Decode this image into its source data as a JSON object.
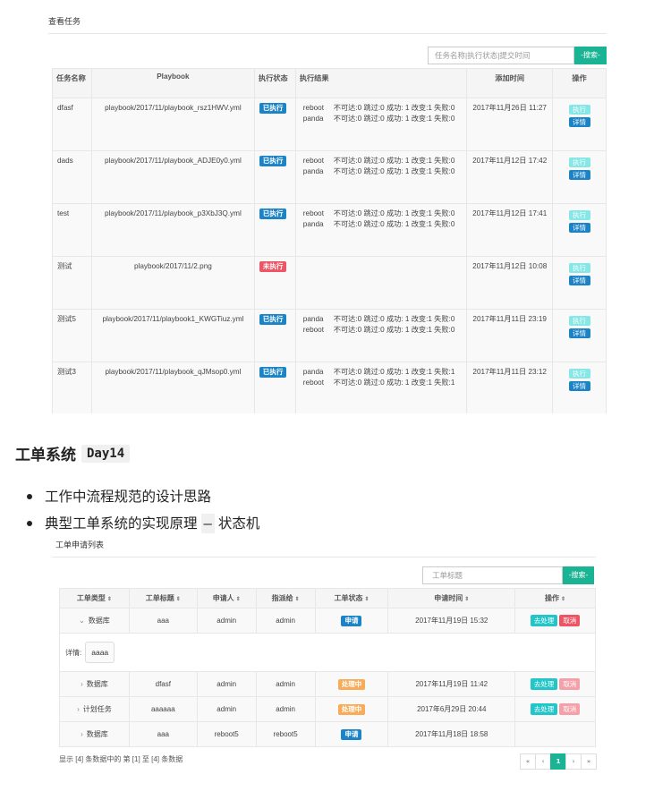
{
  "task_panel": {
    "title": "查看任务",
    "search_placeholder": "任务名称|执行状态|提交时间",
    "search_button": "-搜索-",
    "columns": [
      "任务名称",
      "Playbook",
      "执行状态",
      "执行结果",
      "添加时间",
      "操作"
    ],
    "rows": [
      {
        "name": "dfasf",
        "playbook": "playbook/2017/11/playbook_rsz1HWV.yml",
        "status": "已执行",
        "status_kind": "done",
        "results": [
          {
            "host": "reboot",
            "text": "不可达:0 跳过:0 成功: 1 改变:1 失败:0"
          },
          {
            "host": "panda",
            "text": "不可达:0 跳过:0 成功: 1 改变:1 失败:0"
          }
        ],
        "time": "2017年11月26日 11:27",
        "exec": "执行",
        "detail": "详情"
      },
      {
        "name": "dads",
        "playbook": "playbook/2017/11/playbook_ADJE0y0.yml",
        "status": "已执行",
        "status_kind": "done",
        "results": [
          {
            "host": "reboot",
            "text": "不可达:0 跳过:0 成功: 1 改变:1 失败:0"
          },
          {
            "host": "panda",
            "text": "不可达:0 跳过:0 成功: 1 改变:1 失败:0"
          }
        ],
        "time": "2017年11月12日 17:42",
        "exec": "执行",
        "detail": "详情"
      },
      {
        "name": "test",
        "playbook": "playbook/2017/11/playbook_p3XbJ3Q.yml",
        "status": "已执行",
        "status_kind": "done",
        "results": [
          {
            "host": "reboot",
            "text": "不可达:0 跳过:0 成功: 1 改变:1 失败:0"
          },
          {
            "host": "panda",
            "text": "不可达:0 跳过:0 成功: 1 改变:1 失败:0"
          }
        ],
        "time": "2017年11月12日 17:41",
        "exec": "执行",
        "detail": "详情"
      },
      {
        "name": "测试",
        "playbook": "playbook/2017/11/2.png",
        "status": "未执行",
        "status_kind": "pending",
        "results": [],
        "time": "2017年11月12日 10:08",
        "exec": "执行",
        "detail": "详情"
      },
      {
        "name": "测试5",
        "playbook": "playbook/2017/11/playbook1_KWGTiuz.yml",
        "status": "已执行",
        "status_kind": "done",
        "results": [
          {
            "host": "panda",
            "text": "不可达:0 跳过:0 成功: 1 改变:1 失败:0"
          },
          {
            "host": "reboot",
            "text": "不可达:0 跳过:0 成功: 1 改变:1 失败:0"
          }
        ],
        "time": "2017年11月11日 23:19",
        "exec": "执行",
        "detail": "详情"
      },
      {
        "name": "测试3",
        "playbook": "playbook/2017/11/playbook_qJMsop0.yml",
        "status": "已执行",
        "status_kind": "done",
        "results": [
          {
            "host": "panda",
            "text": "不可达:0 跳过:0 成功: 1 改变:1 失败:1"
          },
          {
            "host": "reboot",
            "text": "不可达:0 跳过:0 成功: 1 改变:1 失败:1"
          }
        ],
        "time": "2017年11月11日 23:12",
        "exec": "执行",
        "detail": "详情"
      }
    ]
  },
  "article": {
    "heading": "工单系统",
    "heading_code": "Day14",
    "bullets": [
      {
        "text": "工作中流程规范的设计思路",
        "code": ""
      },
      {
        "text": "典型工单系统的实现原理",
        "code": "—",
        "suffix": "状态机"
      }
    ]
  },
  "ticket_panel": {
    "title": "工单申请列表",
    "search_placeholder": "工单标题",
    "search_button": "-搜索-",
    "columns": [
      "工单类型",
      "工单标题",
      "申请人",
      "指派给",
      "工单状态",
      "申请时间",
      "操作"
    ],
    "detail_label": "详情:",
    "detail_value": "aaaa",
    "rows": [
      {
        "type": "数据库",
        "expanded": true,
        "title": "aaa",
        "applicant": "admin",
        "assignee": "admin",
        "status": "申请",
        "status_kind": "apply",
        "time": "2017年11月19日 15:32",
        "actions": [
          "去处理",
          "取消"
        ],
        "cancel_active": true
      },
      {
        "type": "数据库",
        "expanded": false,
        "title": "dfasf",
        "applicant": "admin",
        "assignee": "admin",
        "status": "处理中",
        "status_kind": "processing",
        "time": "2017年11月19日 11:42",
        "actions": [
          "去处理",
          "取消"
        ],
        "cancel_active": false
      },
      {
        "type": "计划任务",
        "expanded": false,
        "title": "aaaaaa",
        "applicant": "admin",
        "assignee": "admin",
        "status": "处理中",
        "status_kind": "processing",
        "time": "2017年6月29日 20:44",
        "actions": [
          "去处理",
          "取消"
        ],
        "cancel_active": false
      },
      {
        "type": "数据库",
        "expanded": false,
        "title": "aaa",
        "applicant": "reboot5",
        "assignee": "reboot5",
        "status": "申请",
        "status_kind": "apply",
        "time": "2017年11月18日 18:58",
        "actions": [],
        "cancel_active": false
      }
    ],
    "footer": "显示 [4] 条数据中的 第 [1] 至 [4] 条数据",
    "pager": [
      "«",
      "‹",
      "1",
      "›",
      "»"
    ],
    "current_page": "1"
  },
  "colors": {
    "accent": "#1ab394",
    "blue": "#1c84c6",
    "red": "#ed5565",
    "orange": "#f8ac59",
    "cyan": "#23c6c8"
  }
}
